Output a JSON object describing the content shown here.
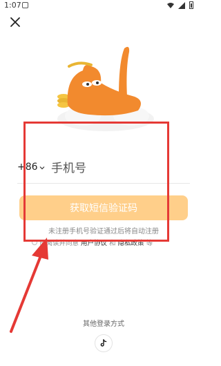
{
  "status_bar": {
    "time": "1:07"
  },
  "phone": {
    "country_code": "+86",
    "placeholder": "手机号"
  },
  "sms_button_label": "获取短信验证码",
  "hint": "未注册手机号验证通过后将自动注册",
  "agreement": {
    "prefix": "已阅读并同意",
    "user_agreement": "用户协议",
    "and": "和",
    "privacy": "隐私政策",
    "suffix": "等"
  },
  "other_login_label": "其他登录方式",
  "colors": {
    "accent": "#ffcf8a",
    "mascot_orange": "#f28a2e",
    "annotation_red": "#e53935"
  },
  "icons": {
    "close": "close-icon",
    "chevron": "chevron-down-icon",
    "tiktok": "tiktok-icon"
  }
}
